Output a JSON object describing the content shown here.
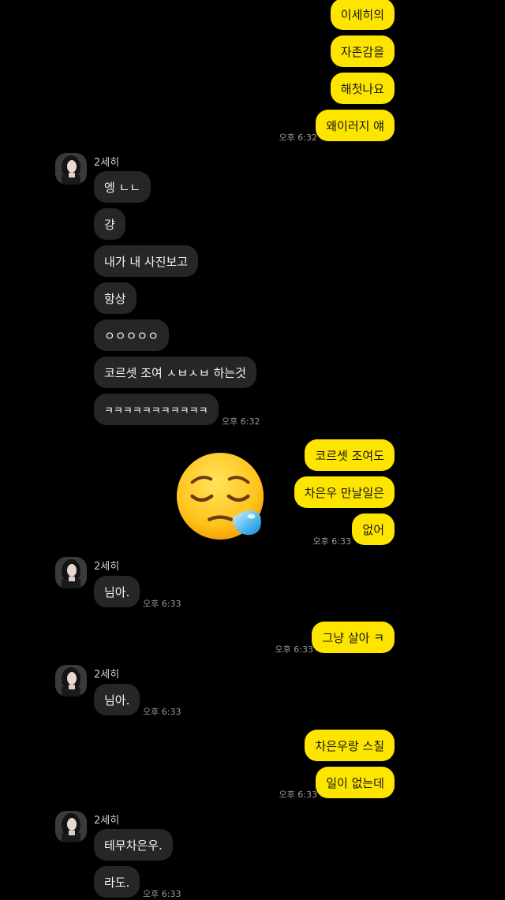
{
  "colors": {
    "background": "#000000",
    "outgoing_bubble": "#FEE500",
    "incoming_bubble": "#262626",
    "timestamp": "#9A9A9A"
  },
  "sender_name": "2세히",
  "groups": [
    {
      "direction": "out",
      "messages": [
        "이세히의",
        "자존감을",
        "해첫나요",
        "왜이러지 얘"
      ],
      "time": "오후 6:32"
    },
    {
      "direction": "in",
      "sender": "2세히",
      "messages": [
        "엥 ㄴㄴ",
        "걍",
        "내가 내 사진보고",
        "항상",
        "ㅇㅇㅇㅇㅇ",
        "코르셋 조여 ㅅㅂㅅㅂ 하는것",
        "ㅋㅋㅋㅋㅋㅋㅋㅋㅋㅋㅋ"
      ],
      "time": "오후 6:32"
    },
    {
      "direction": "out",
      "messages": [
        "코르셋 조여도",
        "차은우 만날일은",
        "없어"
      ],
      "time": "오후 6:33",
      "sticker": "sleepy-face-emoji"
    },
    {
      "direction": "in",
      "sender": "2세히",
      "messages": [
        "님아."
      ],
      "time": "오후 6:33"
    },
    {
      "direction": "out",
      "messages": [
        "그냥 살아 ㅋ"
      ],
      "time": "오후 6:33"
    },
    {
      "direction": "in",
      "sender": "2세히",
      "messages": [
        "님아."
      ],
      "time": "오후 6:33"
    },
    {
      "direction": "out",
      "messages": [
        "차은우랑 스칠",
        "일이 없는데"
      ],
      "time": "오후 6:33"
    },
    {
      "direction": "in",
      "sender": "2세히",
      "messages": [
        "테무차은우.",
        "라도."
      ],
      "time": "오후 6:33"
    }
  ]
}
